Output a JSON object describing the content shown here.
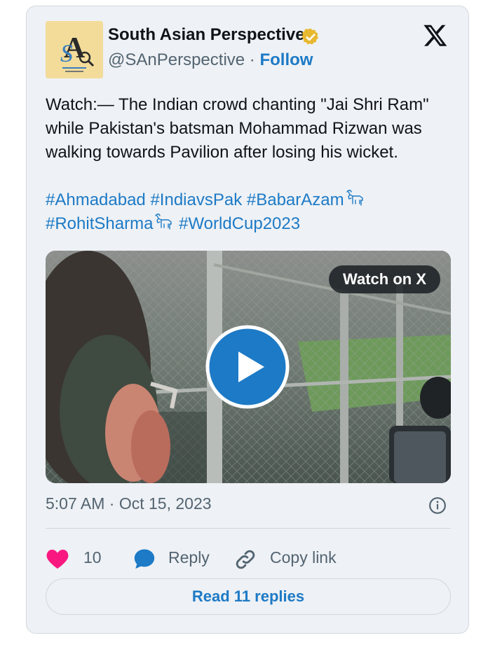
{
  "author": {
    "logo_letter": "S",
    "logo_initial": "A",
    "name": "South Asian Perspective",
    "handle": "@SAnPerspective",
    "separator": "·",
    "follow_label": "Follow"
  },
  "tweet": {
    "text": "Watch:— The Indian crowd chanting \"Jai Shri Ram\" while Pakistan's batsman Mohammad Rizwan was walking towards Pavilion after losing his wicket.",
    "hashtags": [
      "#Ahmadabad",
      "#IndiavsPak",
      "#BabarAzam",
      "#RohitSharma",
      "#WorldCup2023"
    ]
  },
  "media": {
    "watch_label": "Watch on X"
  },
  "meta": {
    "time": "5:07 AM",
    "separator": "·",
    "date": "Oct 15, 2023"
  },
  "actions": {
    "like_count": "10",
    "reply_label": "Reply",
    "copy_label": "Copy link"
  },
  "footer": {
    "read_replies_label": "Read 11 replies"
  },
  "colors": {
    "accent": "#1d7ac6",
    "like": "#f91880",
    "card_bg": "#eef1f5"
  }
}
